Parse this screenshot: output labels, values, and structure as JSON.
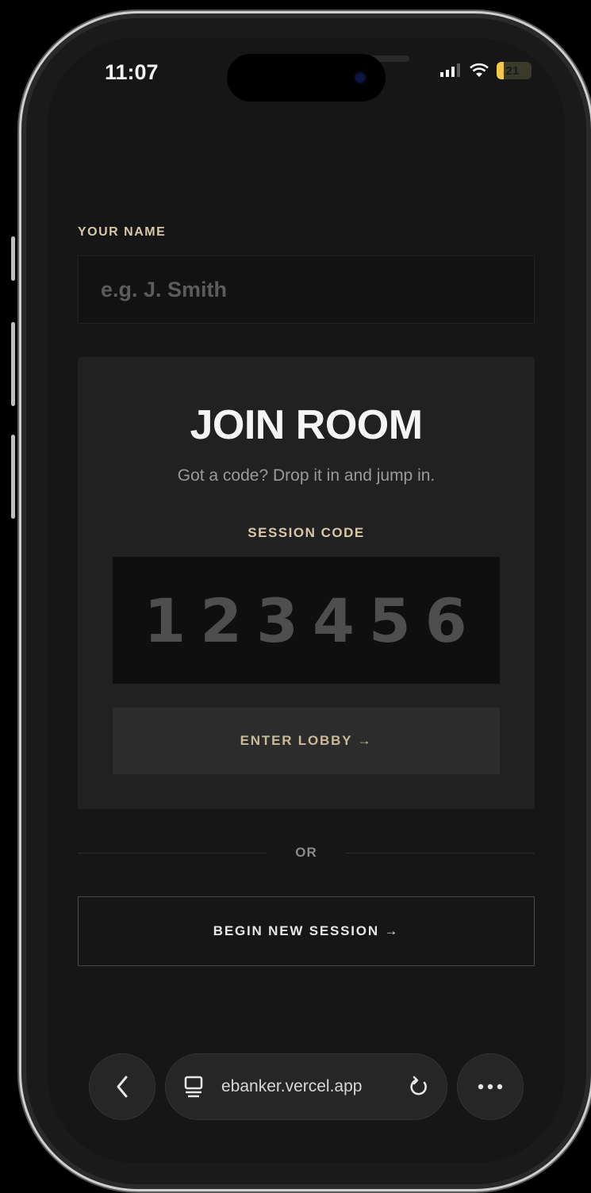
{
  "status_bar": {
    "time": "11:07",
    "battery_level": "21",
    "battery_fraction": 0.21,
    "battery_color": "#f2c94c"
  },
  "form": {
    "name_label": "YOUR NAME",
    "name_placeholder": "e.g. J. Smith",
    "name_value": ""
  },
  "join_room": {
    "title": "JOIN ROOM",
    "subtitle": "Got a code? Drop it in and jump in.",
    "code_label": "SESSION CODE",
    "code_placeholder": "123456",
    "code_value": "",
    "enter_button": "ENTER LOBBY →"
  },
  "divider": {
    "text": "OR"
  },
  "begin_button": "BEGIN NEW SESSION →",
  "browser": {
    "url": "ebanker.vercel.app",
    "back_icon": "chevron-left-icon",
    "tabs_icon": "tabs-icon",
    "reload_icon": "reload-icon",
    "more_icon": "more-icon"
  },
  "colors": {
    "accent_label": "#d6c8a8",
    "background": "#161616",
    "card": "#212121"
  }
}
